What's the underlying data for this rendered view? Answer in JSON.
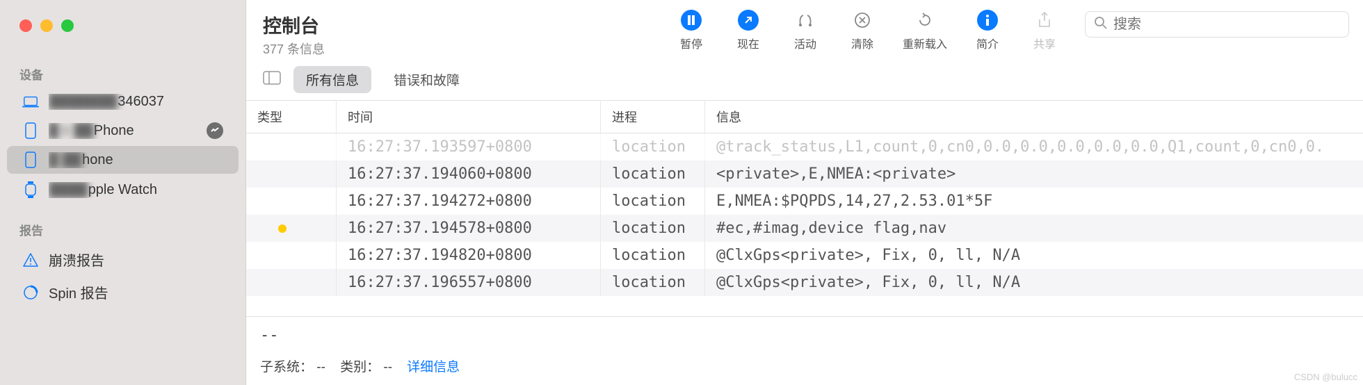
{
  "header": {
    "title": "控制台",
    "subtitle": "377 条信息"
  },
  "toolbar": {
    "pause": "暂停",
    "now": "现在",
    "activity": "活动",
    "clear": "清除",
    "reload": "重新载入",
    "info": "简介",
    "share": "共享"
  },
  "search": {
    "placeholder": "搜索"
  },
  "sidebar": {
    "devices_title": "设备",
    "reports_title": "报告",
    "devices": [
      {
        "label": "███346037",
        "icon": "laptop"
      },
      {
        "label": "█b ██Phone",
        "icon": "phone",
        "badge": true
      },
      {
        "label": "█ ██hone",
        "icon": "phone",
        "selected": true
      },
      {
        "label": "███pple Watch",
        "icon": "watch"
      }
    ],
    "reports": [
      {
        "label": "崩溃报告",
        "icon": "warn"
      },
      {
        "label": "Spin 报告",
        "icon": "spin"
      }
    ]
  },
  "filters": {
    "all": "所有信息",
    "errors": "错误和故障"
  },
  "table": {
    "headers": {
      "type": "类型",
      "time": "时间",
      "process": "进程",
      "message": "信息"
    },
    "rows": [
      {
        "fade": true,
        "type": "",
        "time": "16:27:37.193597+0800",
        "proc": "location",
        "msg": "@track_status,L1,count,0,cn0,0.0,0.0,0.0,0.0,0.0,Q1,count,0,cn0,0."
      },
      {
        "type": "",
        "time": "16:27:37.194060+0800",
        "proc": "location",
        "msg": "<private>,E,NMEA:<private>"
      },
      {
        "type": "",
        "time": "16:27:37.194272+0800",
        "proc": "location",
        "msg": "E,NMEA:$PQPDS,14,27,2.53.01*5F"
      },
      {
        "type": "dot",
        "time": "16:27:37.194578+0800",
        "proc": "location",
        "msg": "#ec,#imag,device flag,nav"
      },
      {
        "type": "",
        "time": "16:27:37.194820+0800",
        "proc": "location",
        "msg": "@ClxGps<private>, Fix, 0, ll, N/A"
      },
      {
        "type": "",
        "time": "16:27:37.196557+0800",
        "proc": "location",
        "msg": "@ClxGps<private>, Fix, 0, ll, N/A"
      }
    ]
  },
  "detail": {
    "dash": "--",
    "subsystem": "子系统：",
    "subsystem_val": "--",
    "category": "类别：",
    "category_val": "--",
    "more": "详细信息"
  },
  "watermark": "CSDN @bulucc"
}
